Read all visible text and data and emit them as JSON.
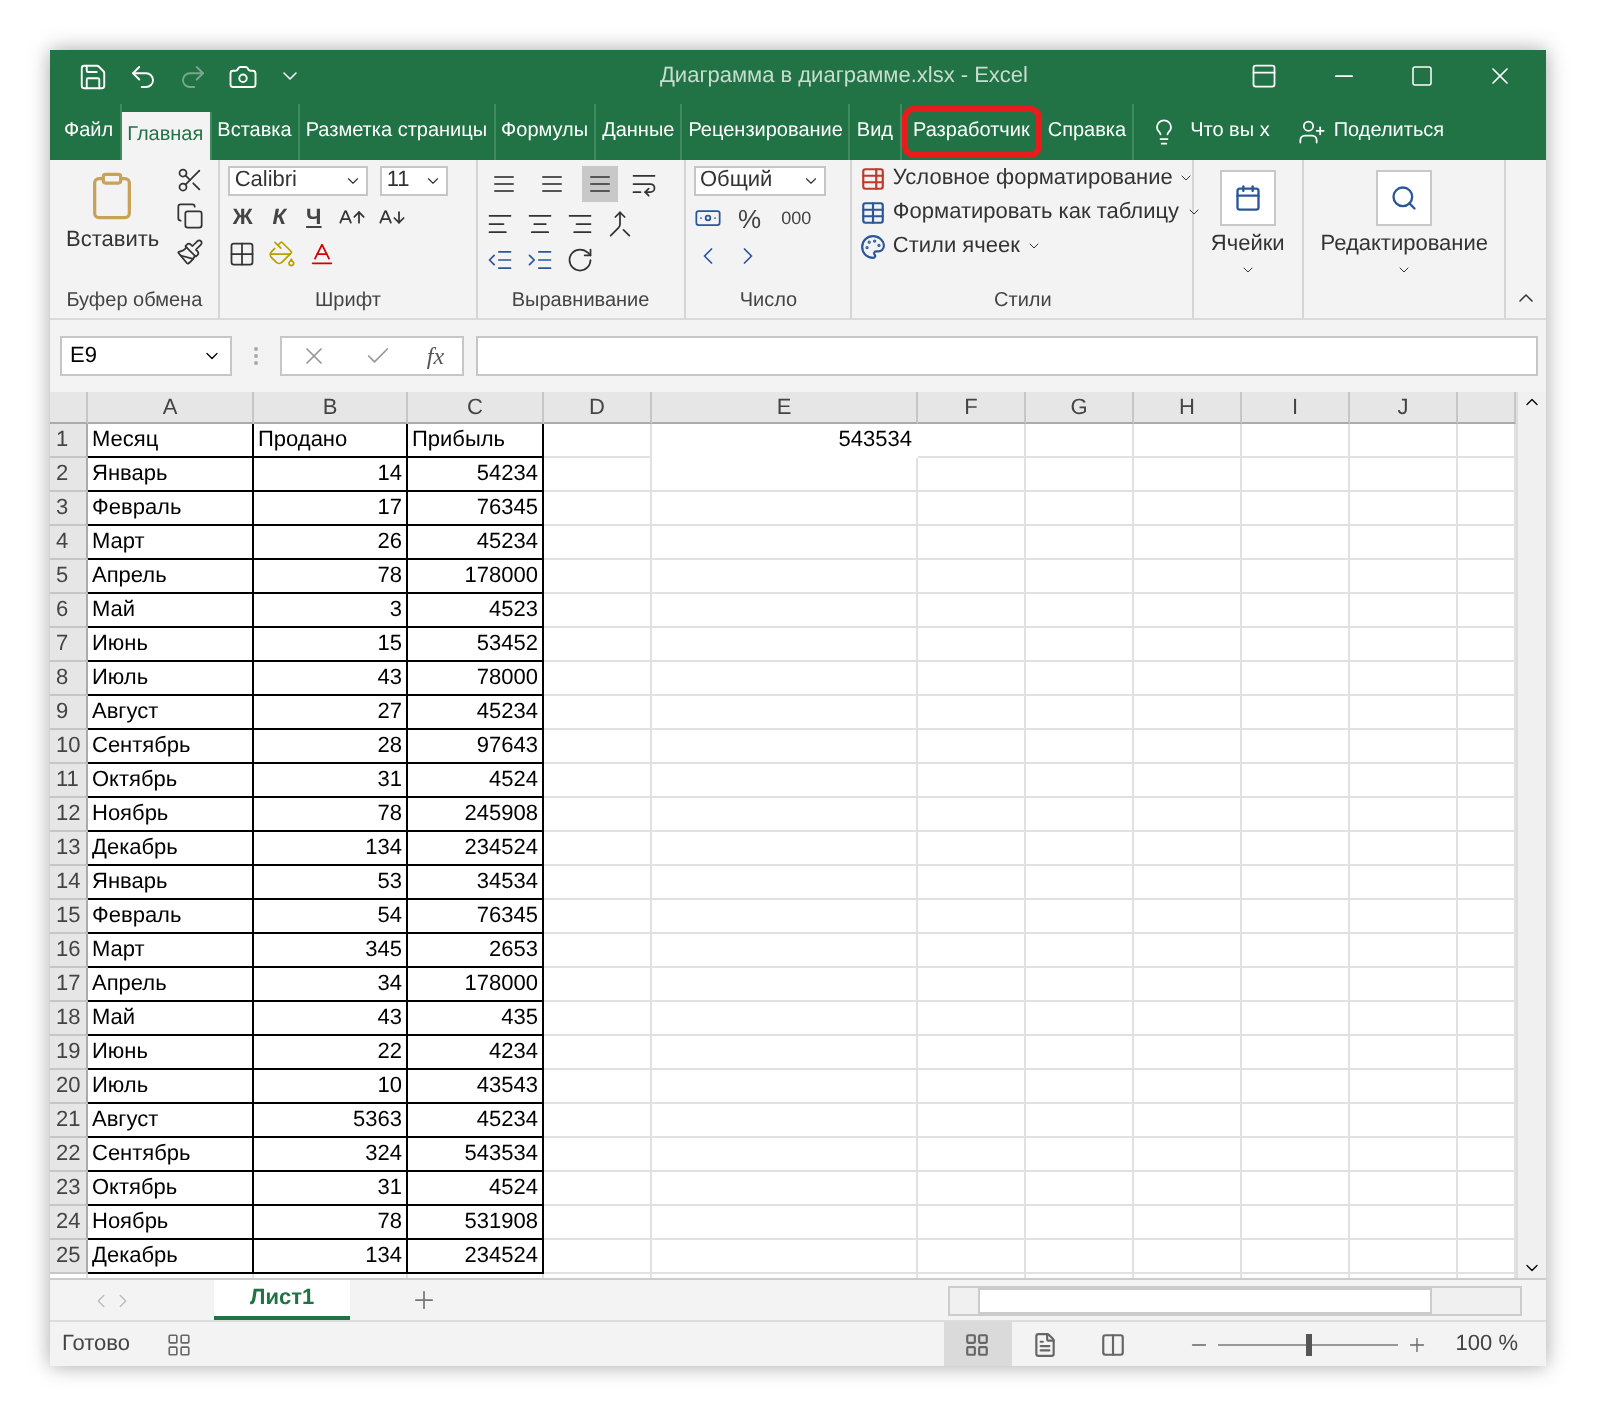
{
  "window": {
    "title": "Диаграмма в диаграмме.xlsx  -  Excel"
  },
  "tabs": [
    {
      "label": "Файл",
      "selected": false,
      "highlighted": false
    },
    {
      "label": "Главная",
      "selected": true,
      "highlighted": false
    },
    {
      "label": "Вставка",
      "selected": false,
      "highlighted": false
    },
    {
      "label": "Разметка страницы",
      "selected": false,
      "highlighted": false
    },
    {
      "label": "Формулы",
      "selected": false,
      "highlighted": false
    },
    {
      "label": "Данные",
      "selected": false,
      "highlighted": false
    },
    {
      "label": "Рецензирование",
      "selected": false,
      "highlighted": false
    },
    {
      "label": "Вид",
      "selected": false,
      "highlighted": false
    },
    {
      "label": "Разработчик",
      "selected": false,
      "highlighted": true
    },
    {
      "label": "Справка",
      "selected": false,
      "highlighted": false
    }
  ],
  "tell_me": "Что вы х",
  "share": "Поделиться",
  "ribbon": {
    "clipboard": {
      "label": "Буфер обмена",
      "paste": "Вставить"
    },
    "font": {
      "label": "Шрифт",
      "name": "Calibri",
      "size": "11",
      "styles": [
        "Ж",
        "К",
        "Ч"
      ]
    },
    "alignment": {
      "label": "Выравнивание",
      "vertical": [
        {
          "selected": false
        },
        {
          "selected": false
        },
        {
          "selected": true
        }
      ]
    },
    "number": {
      "label": "Число",
      "format": "Общий",
      "percent": "%",
      "thousands": "000"
    },
    "styles": {
      "label": "Стили",
      "items": [
        "Условное форматирование",
        "Форматировать как таблицу",
        "Стили ячеек"
      ]
    },
    "big_buttons": [
      {
        "kind": "cells",
        "label": "Ячейки"
      },
      {
        "kind": "editing",
        "label": "Редактирование"
      }
    ]
  },
  "formula_bar": {
    "name_box": "E9",
    "function_label": "fx"
  },
  "columns": [
    "A",
    "B",
    "C",
    "D",
    "E",
    "F",
    "G",
    "H",
    "I",
    "J"
  ],
  "rows": [
    {
      "number": "1",
      "cells": [
        {
          "text": "Месяц",
          "kind": "label"
        },
        {
          "text": "Продано",
          "kind": "label"
        },
        {
          "text": "Прибыль",
          "kind": "label"
        }
      ],
      "column_e": "543534"
    },
    {
      "number": "2",
      "cells": [
        {
          "text": "Январь",
          "kind": "label"
        },
        {
          "text": "14",
          "kind": "number"
        },
        {
          "text": "54234",
          "kind": "number"
        }
      ]
    },
    {
      "number": "3",
      "cells": [
        {
          "text": "Февраль",
          "kind": "label"
        },
        {
          "text": "17",
          "kind": "number"
        },
        {
          "text": "76345",
          "kind": "number"
        }
      ]
    },
    {
      "number": "4",
      "cells": [
        {
          "text": "Март",
          "kind": "label"
        },
        {
          "text": "26",
          "kind": "number"
        },
        {
          "text": "45234",
          "kind": "number"
        }
      ]
    },
    {
      "number": "5",
      "cells": [
        {
          "text": "Апрель",
          "kind": "label"
        },
        {
          "text": "78",
          "kind": "number"
        },
        {
          "text": "178000",
          "kind": "number"
        }
      ]
    },
    {
      "number": "6",
      "cells": [
        {
          "text": "Май",
          "kind": "label"
        },
        {
          "text": "3",
          "kind": "number"
        },
        {
          "text": "4523",
          "kind": "number"
        }
      ]
    },
    {
      "number": "7",
      "cells": [
        {
          "text": "Июнь",
          "kind": "label"
        },
        {
          "text": "15",
          "kind": "number"
        },
        {
          "text": "53452",
          "kind": "number"
        }
      ]
    },
    {
      "number": "8",
      "cells": [
        {
          "text": "Июль",
          "kind": "label"
        },
        {
          "text": "43",
          "kind": "number"
        },
        {
          "text": "78000",
          "kind": "number"
        }
      ]
    },
    {
      "number": "9",
      "cells": [
        {
          "text": "Август",
          "kind": "label"
        },
        {
          "text": "27",
          "kind": "number"
        },
        {
          "text": "45234",
          "kind": "number"
        }
      ]
    },
    {
      "number": "10",
      "cells": [
        {
          "text": "Сентябрь",
          "kind": "label"
        },
        {
          "text": "28",
          "kind": "number"
        },
        {
          "text": "97643",
          "kind": "number"
        }
      ]
    },
    {
      "number": "11",
      "cells": [
        {
          "text": "Октябрь",
          "kind": "label"
        },
        {
          "text": "31",
          "kind": "number"
        },
        {
          "text": "4524",
          "kind": "number"
        }
      ]
    },
    {
      "number": "12",
      "cells": [
        {
          "text": "Ноябрь",
          "kind": "label"
        },
        {
          "text": "78",
          "kind": "number"
        },
        {
          "text": "245908",
          "kind": "number"
        }
      ]
    },
    {
      "number": "13",
      "cells": [
        {
          "text": "Декабрь",
          "kind": "label"
        },
        {
          "text": "134",
          "kind": "number"
        },
        {
          "text": "234524",
          "kind": "number"
        }
      ]
    },
    {
      "number": "14",
      "cells": [
        {
          "text": "Январь",
          "kind": "label"
        },
        {
          "text": "53",
          "kind": "number"
        },
        {
          "text": "34534",
          "kind": "number"
        }
      ]
    },
    {
      "number": "15",
      "cells": [
        {
          "text": "Февраль",
          "kind": "label"
        },
        {
          "text": "54",
          "kind": "number"
        },
        {
          "text": "76345",
          "kind": "number"
        }
      ]
    },
    {
      "number": "16",
      "cells": [
        {
          "text": "Март",
          "kind": "label"
        },
        {
          "text": "345",
          "kind": "number"
        },
        {
          "text": "2653",
          "kind": "number"
        }
      ]
    },
    {
      "number": "17",
      "cells": [
        {
          "text": "Апрель",
          "kind": "label"
        },
        {
          "text": "34",
          "kind": "number"
        },
        {
          "text": "178000",
          "kind": "number"
        }
      ]
    },
    {
      "number": "18",
      "cells": [
        {
          "text": "Май",
          "kind": "label"
        },
        {
          "text": "43",
          "kind": "number"
        },
        {
          "text": "435",
          "kind": "number"
        }
      ]
    },
    {
      "number": "19",
      "cells": [
        {
          "text": "Июнь",
          "kind": "label"
        },
        {
          "text": "22",
          "kind": "number"
        },
        {
          "text": "4234",
          "kind": "number"
        }
      ]
    },
    {
      "number": "20",
      "cells": [
        {
          "text": "Июль",
          "kind": "label"
        },
        {
          "text": "10",
          "kind": "number"
        },
        {
          "text": "43543",
          "kind": "number"
        }
      ]
    },
    {
      "number": "21",
      "cells": [
        {
          "text": "Август",
          "kind": "label"
        },
        {
          "text": "5363",
          "kind": "number"
        },
        {
          "text": "45234",
          "kind": "number"
        }
      ]
    },
    {
      "number": "22",
      "cells": [
        {
          "text": "Сентябрь",
          "kind": "label"
        },
        {
          "text": "324",
          "kind": "number"
        },
        {
          "text": "543534",
          "kind": "number"
        }
      ]
    },
    {
      "number": "23",
      "cells": [
        {
          "text": "Октябрь",
          "kind": "label"
        },
        {
          "text": "31",
          "kind": "number"
        },
        {
          "text": "4524",
          "kind": "number"
        }
      ]
    },
    {
      "number": "24",
      "cells": [
        {
          "text": "Ноябрь",
          "kind": "label"
        },
        {
          "text": "78",
          "kind": "number"
        },
        {
          "text": "531908",
          "kind": "number"
        }
      ]
    },
    {
      "number": "25",
      "cells": [
        {
          "text": "Декабрь",
          "kind": "label"
        },
        {
          "text": "134",
          "kind": "number"
        },
        {
          "text": "234524",
          "kind": "number"
        }
      ]
    }
  ],
  "sheets": [
    {
      "label": "Лист1",
      "selected": true
    }
  ],
  "status_bar": {
    "status": "Готово",
    "views": [
      {
        "selected": true
      },
      {
        "selected": false
      },
      {
        "selected": false
      }
    ],
    "zoom": "100 %",
    "zoom_slider": {
      "level": 0.5
    }
  }
}
